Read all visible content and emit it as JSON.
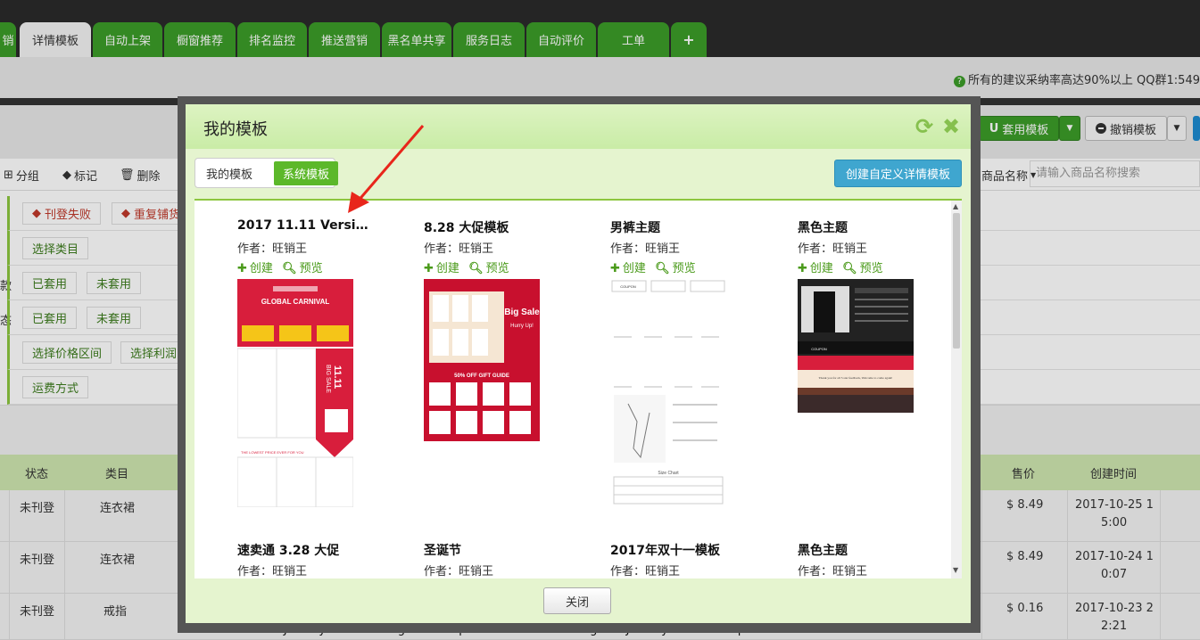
{
  "tabs": [
    "销",
    "详情模板",
    "自动上架",
    "橱窗推荐",
    "排名监控",
    "推送营销",
    "黑名单共享",
    "服务日志",
    "自动评价",
    "工单",
    "+"
  ],
  "tip": {
    "icon": "?",
    "text": "所有的建议采纳率高达90%以上 QQ群1:549"
  },
  "toolbar": {
    "apply_label": "套用模板",
    "apply_icon": "U",
    "revoke_label": "撤销模板",
    "revoke_icon": "minus-circle-icon"
  },
  "actions": {
    "group": "分组",
    "mark": "标记",
    "delete": "删除",
    "field": "商品名称",
    "search_placeholder": "请输入商品名称搜索"
  },
  "filters": {
    "row1": [
      "刊登失败",
      "重复铺货"
    ],
    "row2": [
      "选择类目"
    ],
    "row3_left": "款",
    "row3": [
      "已套用",
      "未套用"
    ],
    "row4_left": "态",
    "row4": [
      "已套用",
      "未套用"
    ],
    "row5": [
      "选择价格区间",
      "选择利润区"
    ],
    "row6": [
      "运费方式"
    ]
  },
  "table": {
    "headers": {
      "status": "状态",
      "category": "类目",
      "price": "售价",
      "created": "创建时间"
    },
    "rows": [
      {
        "status": "未刊登",
        "category": "连衣裙",
        "price": "$ 8.49",
        "created1": "2017-10-25 1",
        "created2": "5:00"
      },
      {
        "status": "未刊登",
        "category": "连衣裙",
        "price": "$ 8.49",
        "created1": "2017-10-24 1",
        "created2": "0:07"
      },
      {
        "status": "未刊登",
        "category": "戒指",
        "price": "$ 0.16",
        "created1": "2017-10-23 2",
        "created2": "2:21"
      }
    ],
    "bottom_title": "Jewelry Gift Box Ring Pendeloque Cut Ear Nail Packing Box Jewelry Fashion Exq"
  },
  "modal": {
    "title": "我的模板",
    "tab_mine": "我的模板",
    "tab_system": "系统模板",
    "create_custom": "创建自定义详情模板",
    "close": "关闭",
    "create_link": "创建",
    "preview_link": "预览",
    "templates": [
      {
        "title": "2017 11.11 Versio...",
        "author": "作者：旺销王"
      },
      {
        "title": "8.28 大促模板",
        "author": "作者：旺销王"
      },
      {
        "title": "男裤主题",
        "author": "作者：旺销王"
      },
      {
        "title": "黑色主题",
        "author": "作者：旺销王"
      },
      {
        "title": "速卖通 3.28 大促",
        "author": "作者：旺销王"
      },
      {
        "title": "圣诞节",
        "author": "作者：旺销王"
      },
      {
        "title": "2017年双十一模板",
        "author": "作者：旺销王"
      },
      {
        "title": "黑色主题",
        "author": "作者：旺销王"
      }
    ],
    "thumb1": {
      "banner": "GLOBAL CARNIVAL",
      "big": "11.11",
      "side": "BIG SALE",
      "footer": "THE LOWEST PRICE EVER FOR YOU"
    },
    "thumb2": {
      "big": "Big Sale",
      "sub": "Hurry Up!",
      "guide": "50% OFF GIFT GUIDE"
    },
    "thumb3": {
      "coupon": "COUPON",
      "size": "Size Chart"
    },
    "thumb4": {
      "coupon": "COUPON",
      "thanks": "Thank you for all 5 star feedback,  Welcome to come again!"
    }
  },
  "colors": {
    "green": "#3c9c28",
    "accent_red": "#d81e3c",
    "blue": "#3fa6cf"
  }
}
